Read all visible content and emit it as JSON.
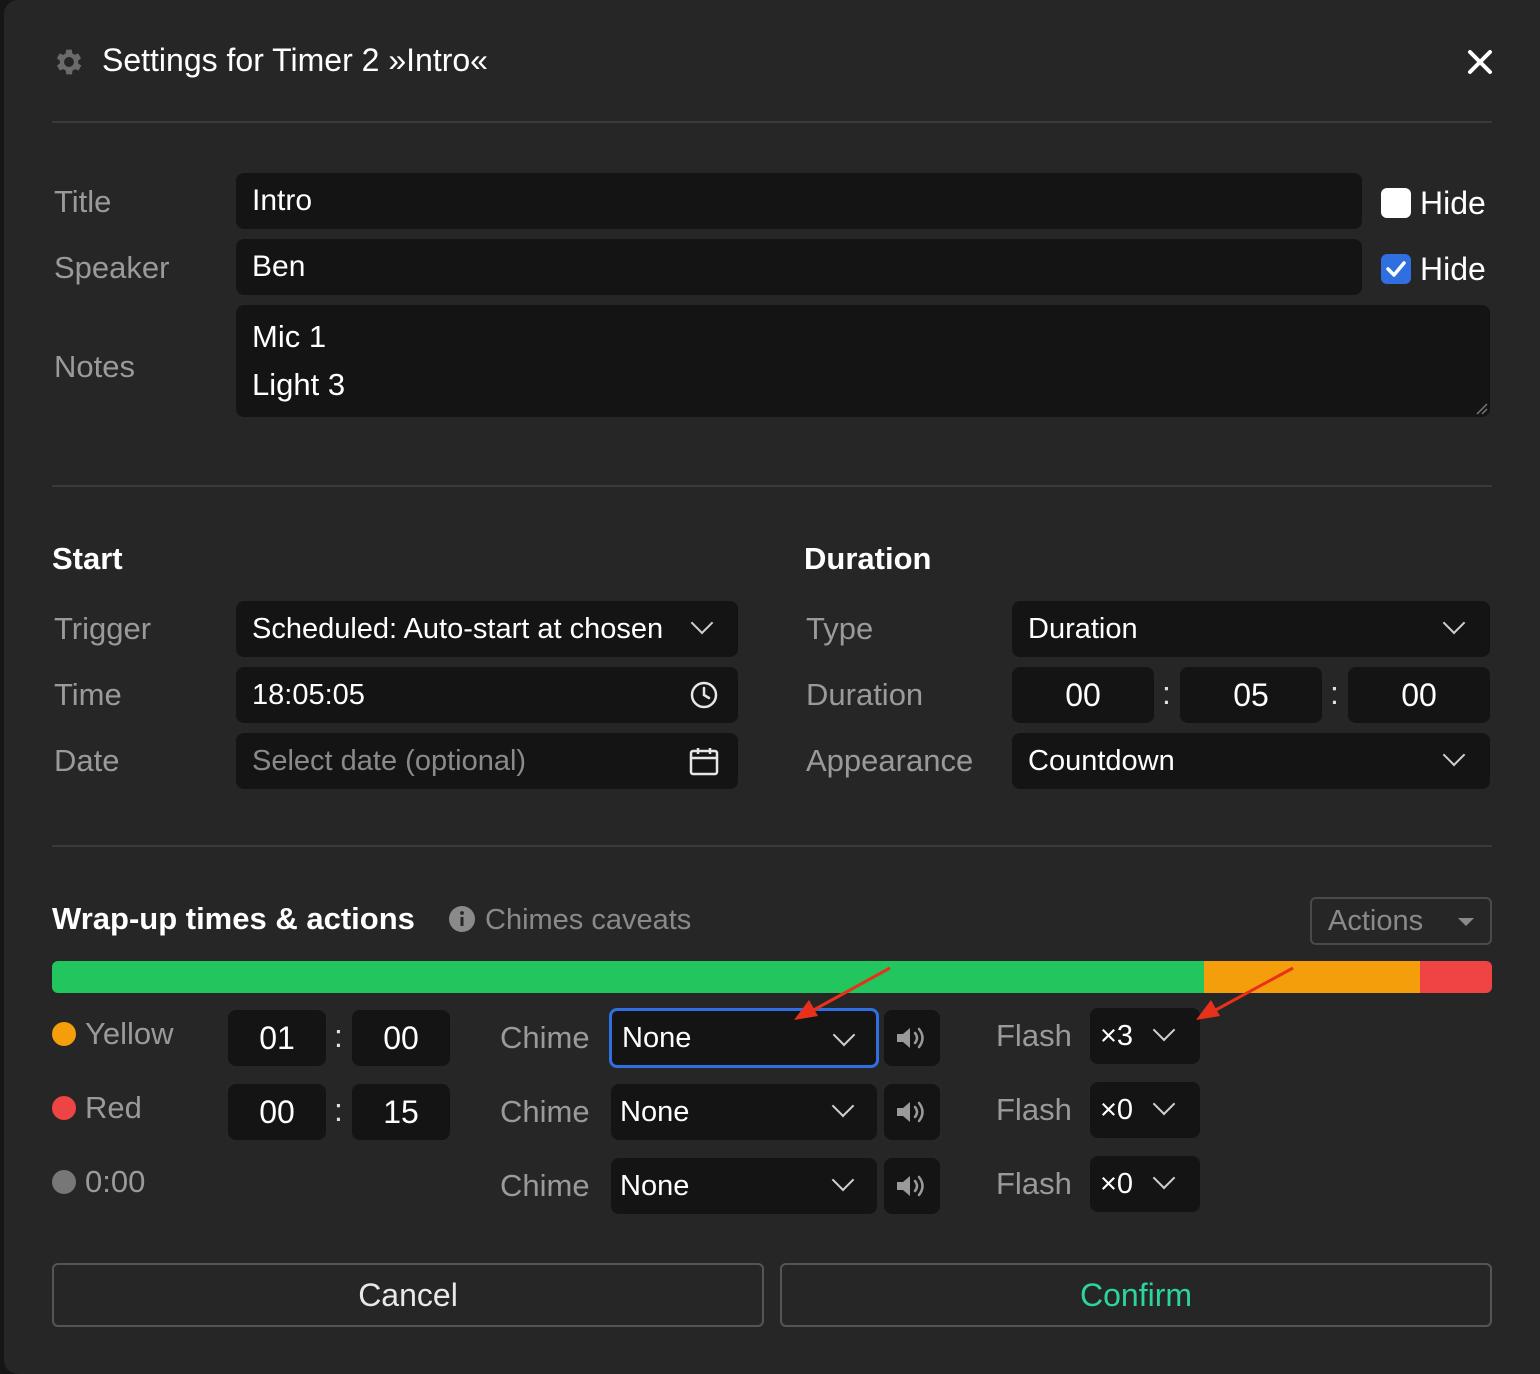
{
  "dialog": {
    "title": "Settings for Timer 2 »Intro«"
  },
  "fields": {
    "title_label": "Title",
    "title_value": "Intro",
    "title_hide_label": "Hide",
    "title_hide_checked": false,
    "speaker_label": "Speaker",
    "speaker_value": "Ben",
    "speaker_hide_label": "Hide",
    "speaker_hide_checked": true,
    "notes_label": "Notes",
    "notes_line1": "Mic 1",
    "notes_line2": "Light 3"
  },
  "start": {
    "heading": "Start",
    "trigger_label": "Trigger",
    "trigger_value": "Scheduled: Auto-start at chosen",
    "time_label": "Time",
    "time_value": "18:05:05",
    "date_label": "Date",
    "date_placeholder": "Select date (optional)"
  },
  "duration": {
    "heading": "Duration",
    "type_label": "Type",
    "type_value": "Duration",
    "duration_label": "Duration",
    "hours": "00",
    "minutes": "05",
    "seconds": "00",
    "appearance_label": "Appearance",
    "appearance_value": "Countdown"
  },
  "wrapup": {
    "heading": "Wrap-up times & actions",
    "caveats_link": "Chimes caveats",
    "actions_label": "Actions",
    "progress": [
      {
        "color": "#22c55e",
        "fraction": 0.8
      },
      {
        "color": "#f59e0b",
        "fraction": 0.15
      },
      {
        "color": "#ef4444",
        "fraction": 0.05
      }
    ],
    "rows": [
      {
        "name": "Yellow",
        "color": "#f59e0b",
        "min": "01",
        "sec": "00",
        "chime_label": "Chime",
        "chime": "None",
        "flash_label": "Flash",
        "flash": "×3"
      },
      {
        "name": "Red",
        "color": "#ef4444",
        "min": "00",
        "sec": "15",
        "chime_label": "Chime",
        "chime": "None",
        "flash_label": "Flash",
        "flash": "×0"
      },
      {
        "name": "0:00",
        "color": "#777777",
        "chime_label": "Chime",
        "chime": "None",
        "flash_label": "Flash",
        "flash": "×0"
      }
    ]
  },
  "footer": {
    "cancel_label": "Cancel",
    "confirm_label": "Confirm",
    "confirm_color": "#2dd4a0"
  },
  "colors": {
    "accent_focus": "#2f6fe0",
    "annotation_arrow": "#e8311a"
  }
}
